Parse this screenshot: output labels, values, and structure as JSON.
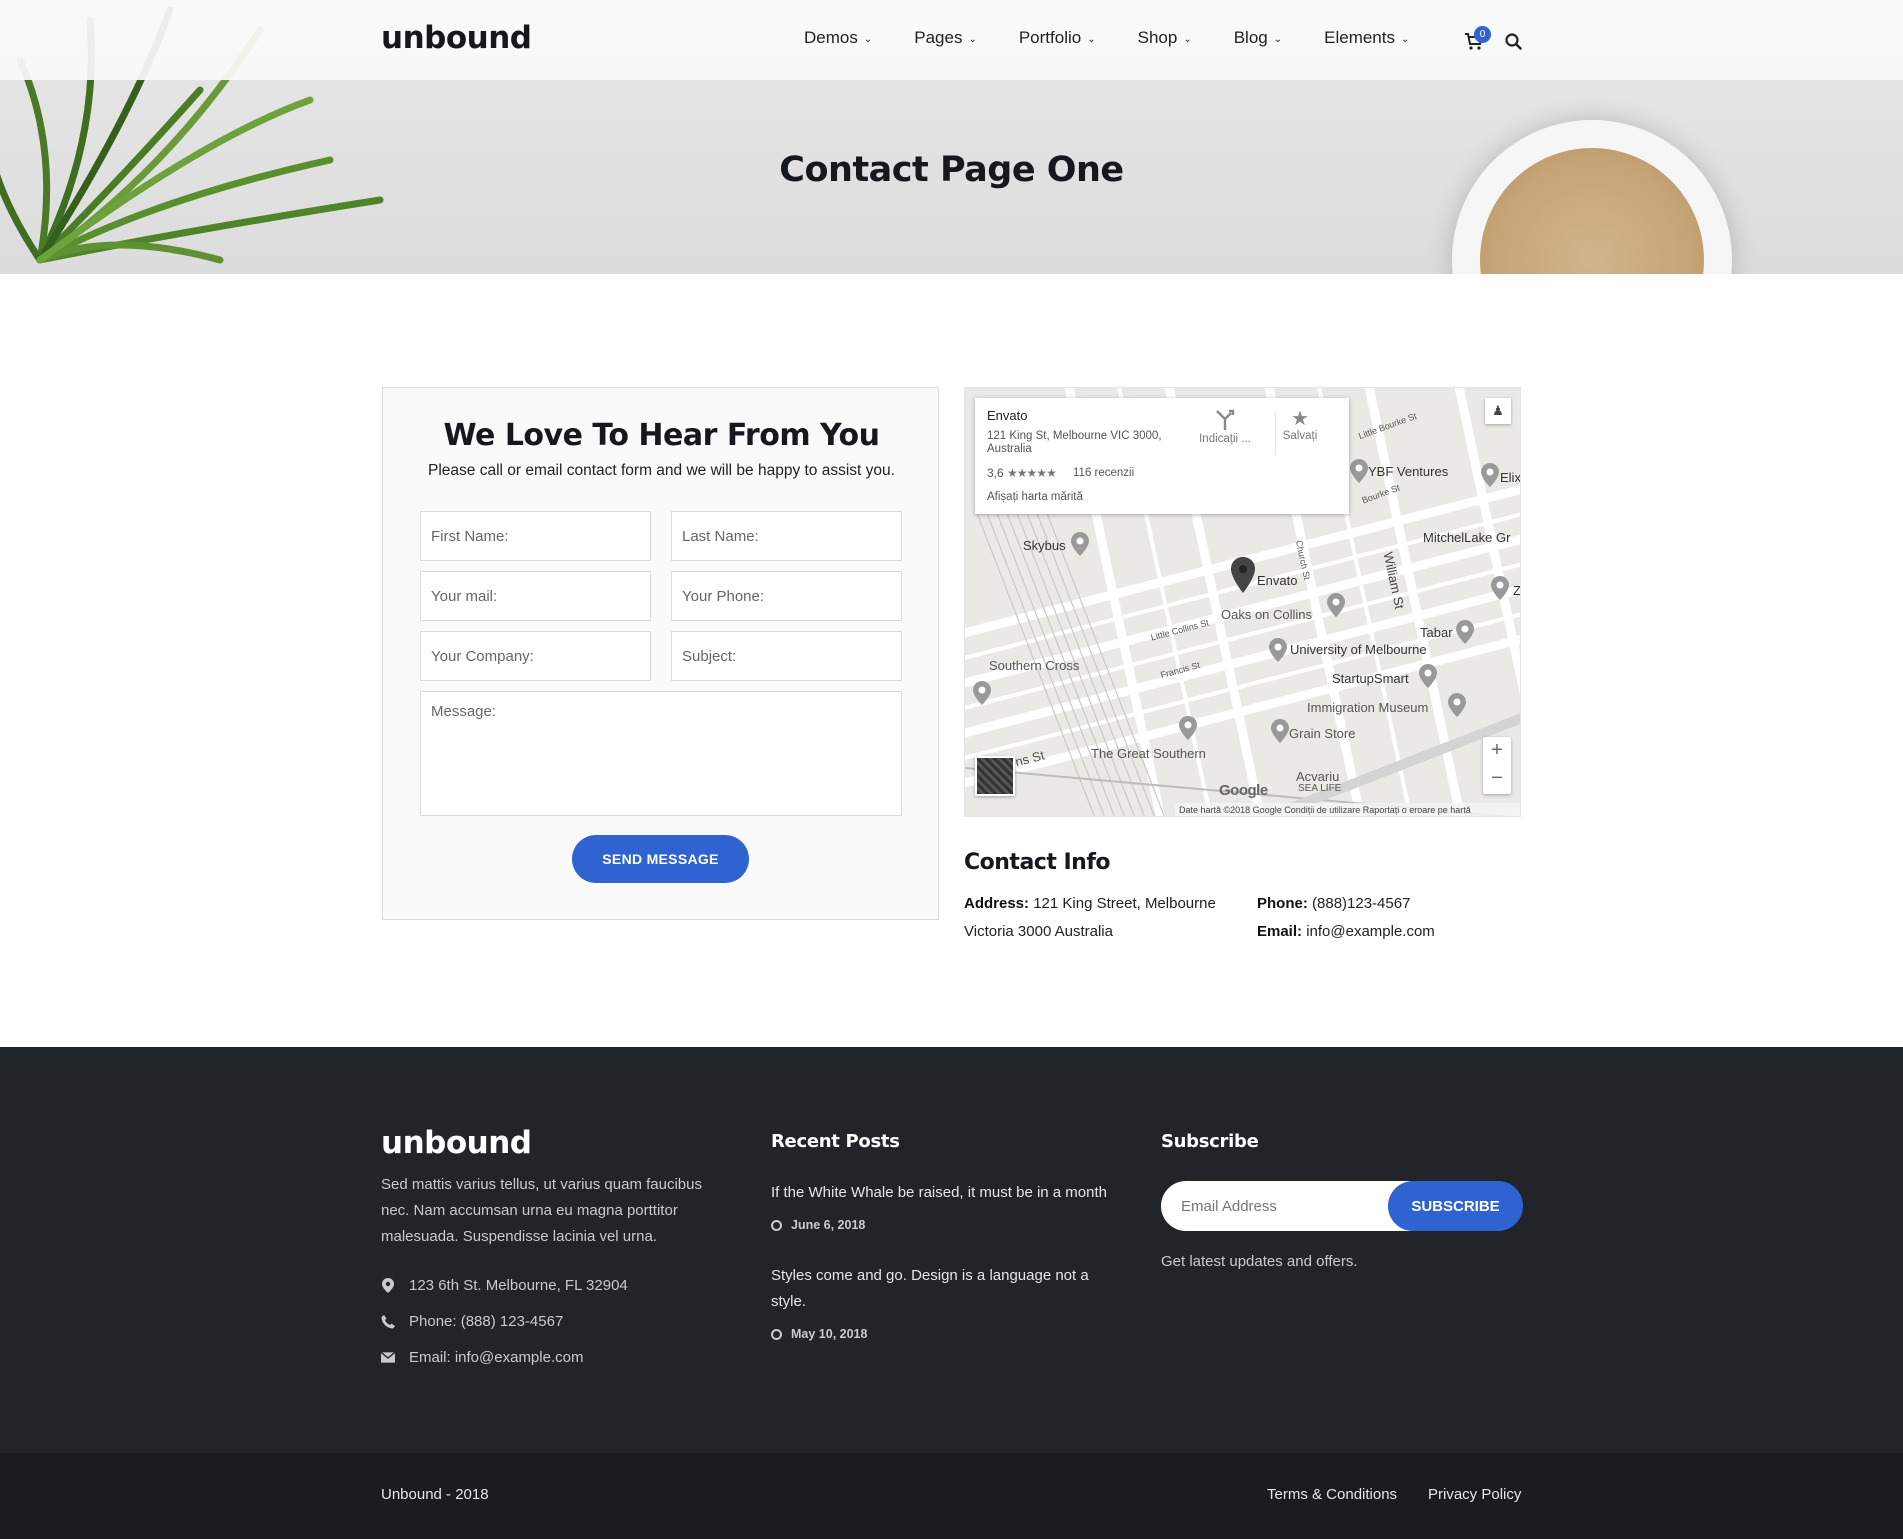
{
  "header": {
    "logo": "unbound",
    "nav": [
      {
        "label": "Demos"
      },
      {
        "label": "Pages"
      },
      {
        "label": "Portfolio"
      },
      {
        "label": "Shop"
      },
      {
        "label": "Blog"
      },
      {
        "label": "Elements"
      }
    ],
    "cart_count": "0",
    "icons": [
      "shopping-cart-icon",
      "search-icon"
    ]
  },
  "hero": {
    "title": "Contact Page One"
  },
  "form": {
    "title": "We Love To Hear From You",
    "subtitle": "Please call or email contact form and we will be happy to assist you.",
    "first_name": "First Name:",
    "last_name": "Last Name:",
    "email": "Your mail:",
    "phone": "Your Phone:",
    "company": "Your Company:",
    "subject": "Subject:",
    "message": "Message:",
    "submit": "SEND MESSAGE"
  },
  "map": {
    "place_name": "Envato",
    "place_address": "121 King St, Melbourne VIC 3000, Australia",
    "rating": "3,6",
    "stars": "★★★★★",
    "reviews": "116 recenzii",
    "view_larger": "Afișați harta mărită",
    "directions": "Indicații ...",
    "save": "Salvați",
    "labels": {
      "skybus": "Skybus",
      "envato": "Envato",
      "oaks": "Oaks on Collins",
      "ybf": "YBF Ventures",
      "elix": "Elix",
      "mitchel": "MitchelLake Gr",
      "unimelb": "University of Melbourne",
      "startupsmart": "StartupSmart",
      "immigration": "Immigration Museum",
      "grain": "Grain Store",
      "southern_cross": "Southern Cross",
      "great_southern": "The Great Southern",
      "acvariu": "Acvariu",
      "sealife": "SEA LIFE",
      "tabar": "Tabar",
      "william_st": "William St",
      "church_st": "Church St",
      "little_collins": "Little Collins St",
      "francis_st": "Francis St",
      "little_bourke": "Little Bourke St",
      "bourke_st": "Bourke St",
      "ns_st": "ns St",
      "z": "Z"
    },
    "google": "Google",
    "footer": "Date hartă ©2018 Google   Condiții de utilizare   Raportați o eroare pe hartă",
    "zoom_in": "+",
    "zoom_out": "−"
  },
  "contact_info": {
    "title": "Contact Info",
    "address_label": "Address:",
    "address_line1": "121 King Street, Melbourne",
    "address_line2": "Victoria 3000 Australia",
    "phone_label": "Phone:",
    "phone": "(888)123-4567",
    "email_label": "Email:",
    "email": "info@example.com"
  },
  "footer": {
    "logo": "unbound",
    "description": "Sed mattis varius tellus, ut varius quam faucibus nec. Nam accumsan urna eu magna porttitor malesuada. Suspendisse lacinia vel urna.",
    "address": "123 6th St. Melbourne, FL 32904",
    "phone": "Phone: (888) 123-4567",
    "email": "Email: info@example.com",
    "recent_posts_title": "Recent Posts",
    "posts": [
      {
        "title": "If the White Whale be raised, it must be in a month",
        "date": "June 6, 2018"
      },
      {
        "title": "Styles come and go. Design is a language not a style.",
        "date": "May 10, 2018"
      }
    ],
    "subscribe_title": "Subscribe",
    "subscribe_placeholder": "Email Address",
    "subscribe_button": "SUBSCRIBE",
    "subscribe_note": "Get latest updates and offers.",
    "copyright": "Unbound - 2018",
    "terms": "Terms & Conditions",
    "privacy": "Privacy Policy"
  },
  "colors": {
    "accent": "#2f63d1",
    "footer_bg": "#212529",
    "footer_bottom_bg": "#1a1d20",
    "hero_bg": "#e0e0e0"
  }
}
